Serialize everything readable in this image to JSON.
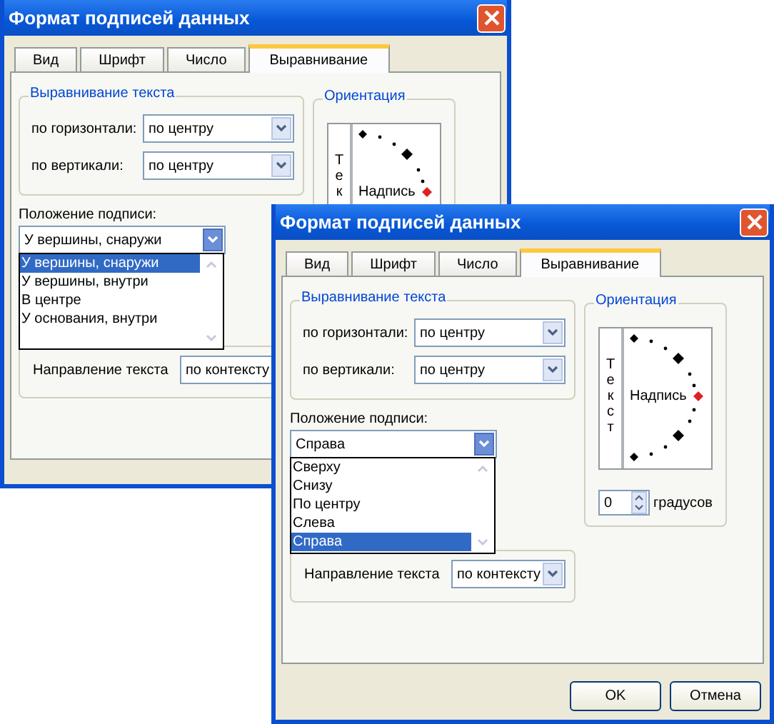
{
  "dialogs": [
    {
      "title": "Формат подписей данных",
      "tabs": [
        {
          "label": "Вид",
          "selected": false
        },
        {
          "label": "Шрифт",
          "selected": false
        },
        {
          "label": "Число",
          "selected": false
        },
        {
          "label": "Выравнивание",
          "selected": true
        }
      ],
      "alignment": {
        "title": "Выравнивание текста",
        "horizontal": {
          "label": "по горизонтали:",
          "value": "по центру"
        },
        "vertical": {
          "label": "по вертикали:",
          "value": "по центру"
        }
      },
      "orientation": {
        "title": "Ориентация",
        "vertical_text": "Тек",
        "label": "Надпись"
      },
      "position": {
        "label": "Положение подписи:",
        "value": "У вершины, снаружи",
        "options": [
          {
            "label": "У вершины, снаружи",
            "selected": true
          },
          {
            "label": "У вершины, внутри",
            "selected": false
          },
          {
            "label": "В центре",
            "selected": false
          },
          {
            "label": "У основания, внутри",
            "selected": false
          }
        ]
      },
      "direction": {
        "label": "Направление текста",
        "value": "по контексту"
      }
    },
    {
      "title": "Формат подписей данных",
      "tabs": [
        {
          "label": "Вид",
          "selected": false
        },
        {
          "label": "Шрифт",
          "selected": false
        },
        {
          "label": "Число",
          "selected": false
        },
        {
          "label": "Выравнивание",
          "selected": true
        }
      ],
      "alignment": {
        "title": "Выравнивание текста",
        "horizontal": {
          "label": "по горизонтали:",
          "value": "по центру"
        },
        "vertical": {
          "label": "по вертикали:",
          "value": "по центру"
        }
      },
      "orientation": {
        "title": "Ориентация",
        "vertical_text": "Текст",
        "label": "Надпись"
      },
      "degrees": {
        "value": "0",
        "unit": "градусов"
      },
      "position": {
        "label": "Положение подписи:",
        "value": "Справа",
        "options": [
          {
            "label": "Сверху",
            "selected": false
          },
          {
            "label": "Снизу",
            "selected": false
          },
          {
            "label": "По центру",
            "selected": false
          },
          {
            "label": "Слева",
            "selected": false
          },
          {
            "label": "Справа",
            "selected": true
          }
        ]
      },
      "direction": {
        "label": "Направление текста",
        "value": "по контексту"
      },
      "buttons": [
        "OK",
        "Отмена"
      ]
    }
  ]
}
